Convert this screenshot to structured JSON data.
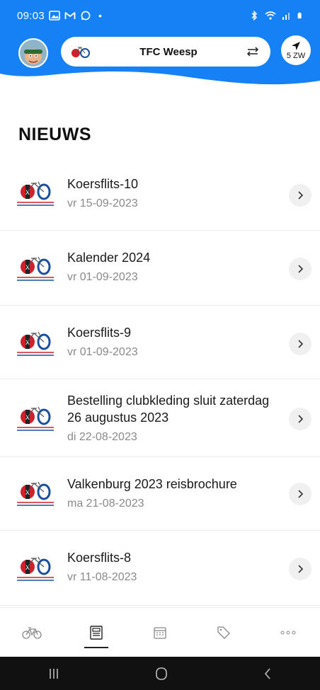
{
  "status_bar": {
    "time": "09:03",
    "dot": "•"
  },
  "header": {
    "club_name": "TFC Weesp",
    "wind": "5 ZW"
  },
  "page_title": "NIEUWS",
  "news": [
    {
      "title": "Koersflits-10",
      "date": "vr 15-09-2023"
    },
    {
      "title": "Kalender 2024",
      "date": "vr 01-09-2023"
    },
    {
      "title": "Koersflits-9",
      "date": "vr 01-09-2023"
    },
    {
      "title": "Bestelling clubkleding sluit zaterdag 26 augustus 2023",
      "date": "di 22-08-2023"
    },
    {
      "title": "Valkenburg 2023 reisbrochure",
      "date": "ma 21-08-2023"
    },
    {
      "title": "Koersflits-8",
      "date": "vr 11-08-2023"
    }
  ],
  "nav": {
    "items": [
      "bike-icon",
      "news-icon",
      "calendar-icon",
      "tag-icon",
      "more-icon"
    ],
    "active": "news-icon"
  },
  "colors": {
    "header_blue": "#1680f5",
    "accent_red": "#d0202a"
  }
}
